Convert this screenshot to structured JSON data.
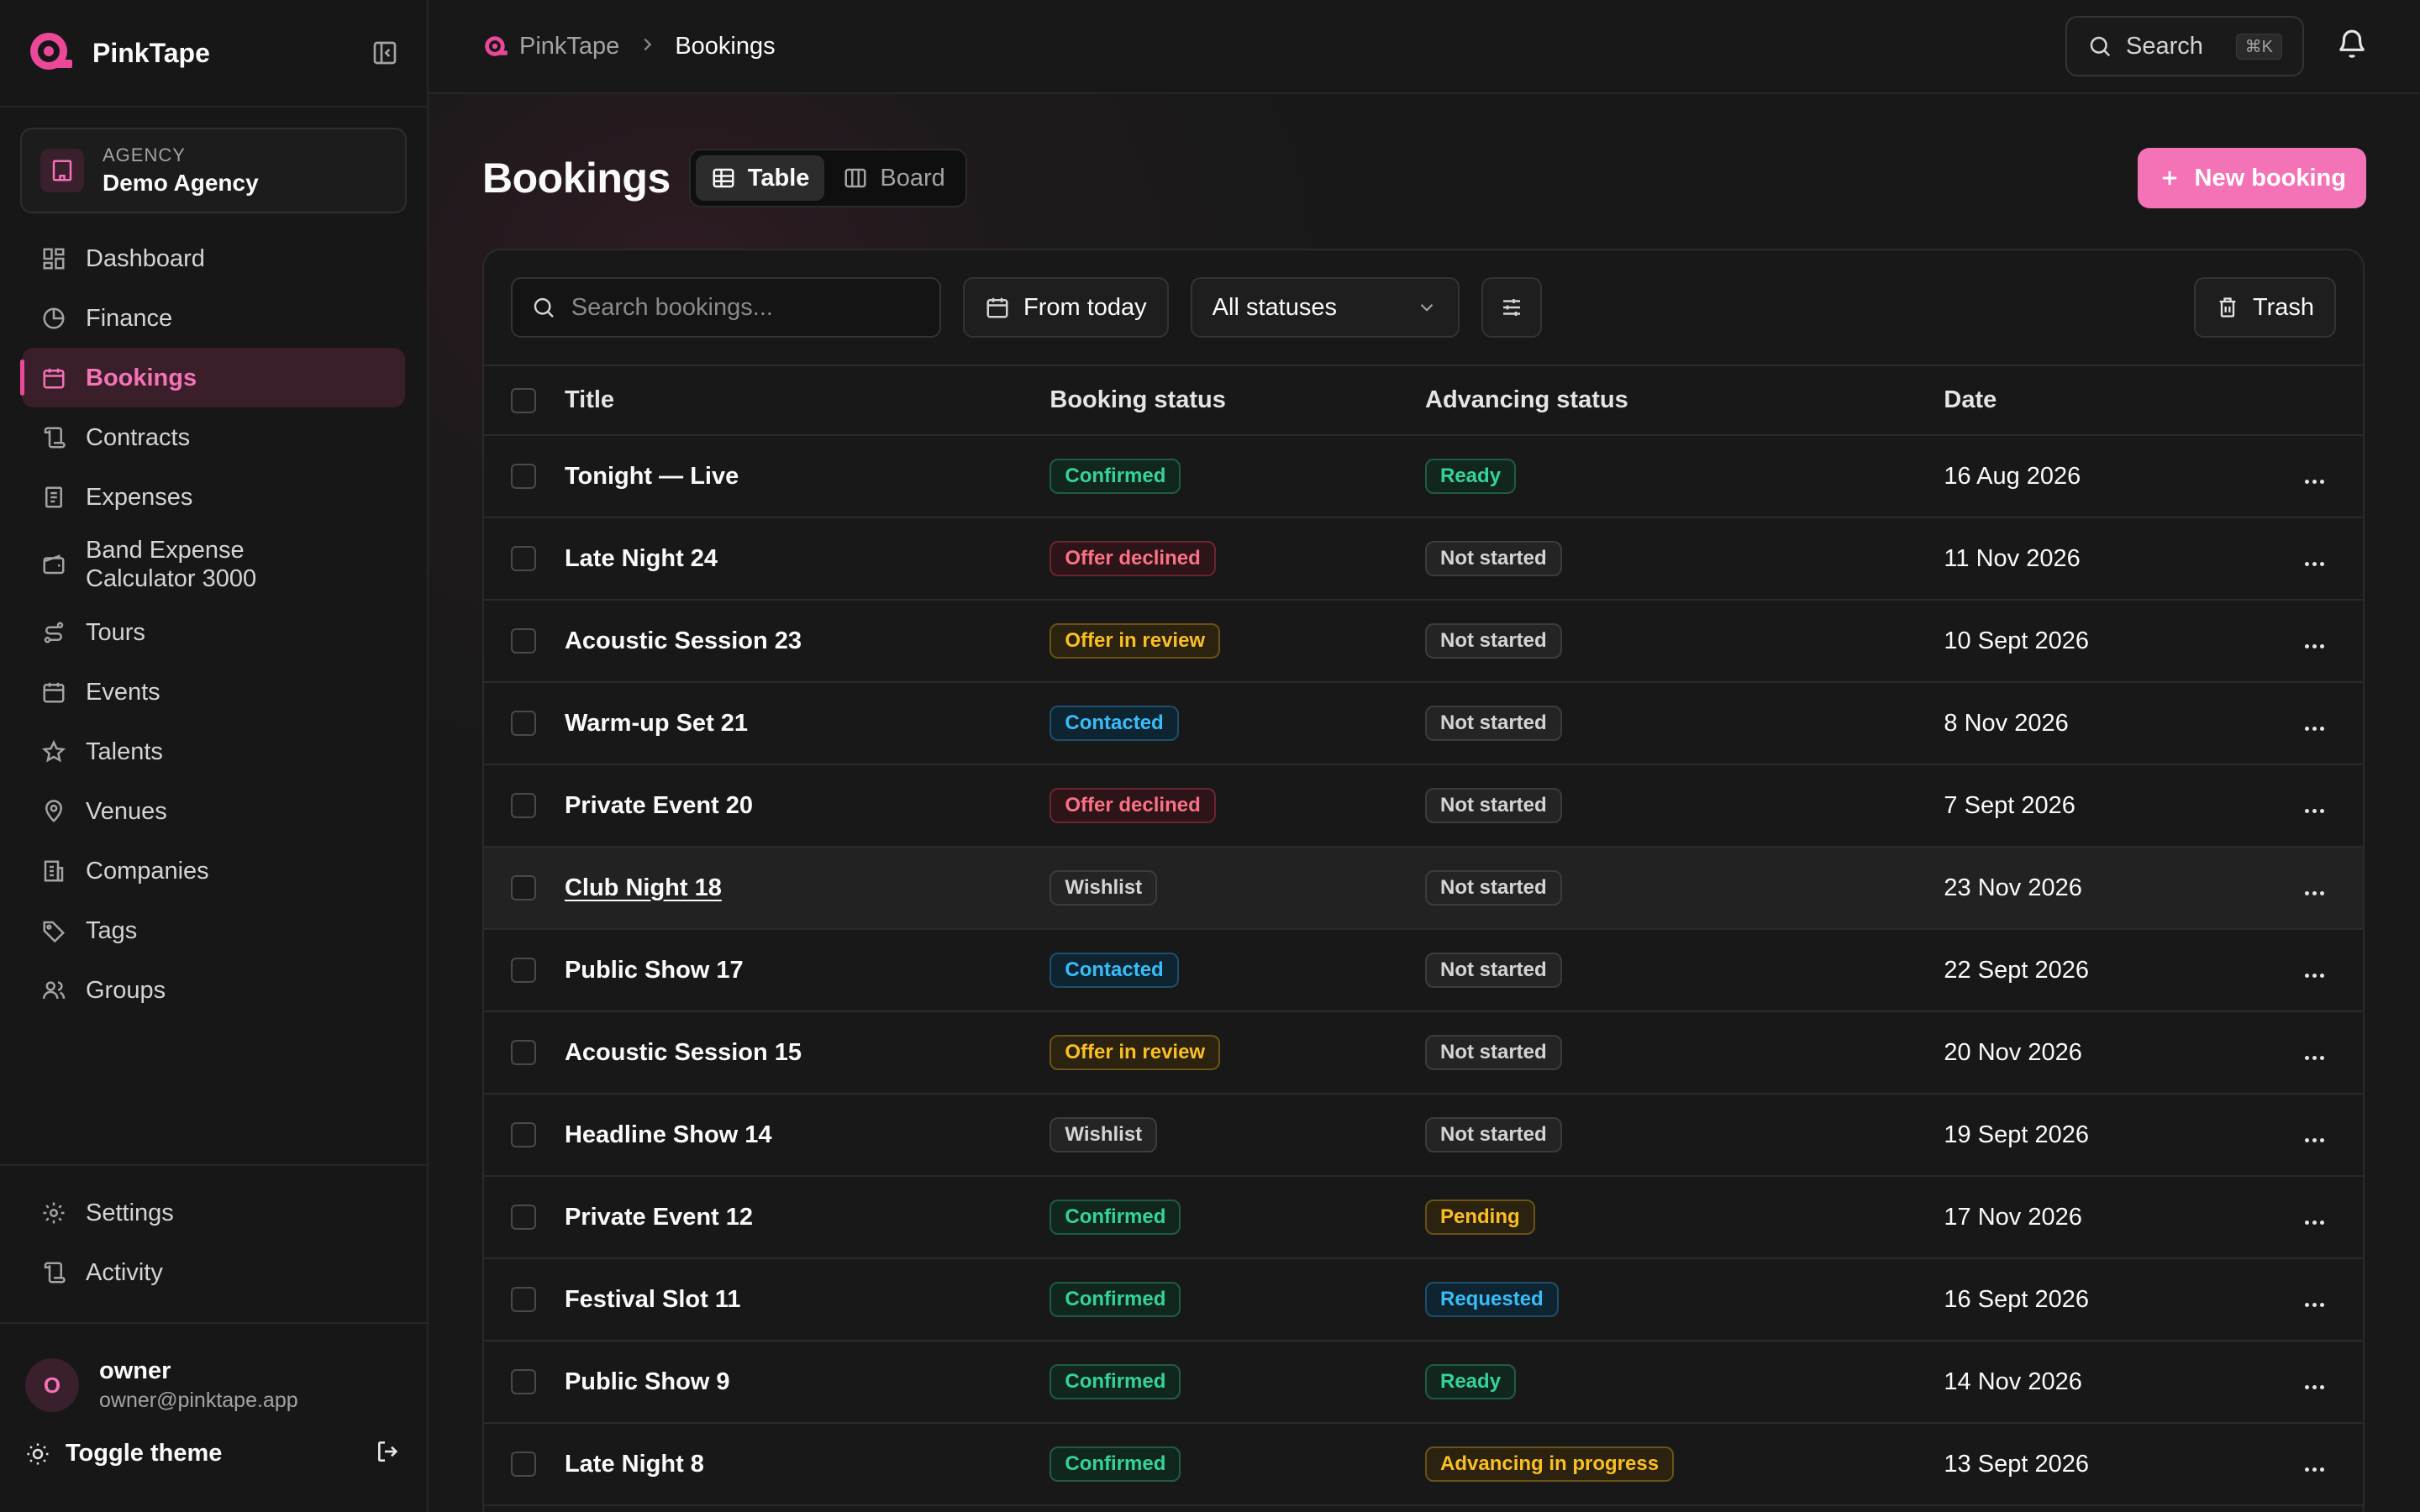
{
  "app": {
    "name": "PinkTape"
  },
  "org": {
    "kicker": "AGENCY",
    "name": "Demo Agency"
  },
  "nav": [
    {
      "label": "Dashboard",
      "icon": "dashboard-icon"
    },
    {
      "label": "Finance",
      "icon": "pie-chart-icon"
    },
    {
      "label": "Bookings",
      "icon": "calendar-icon",
      "active": true
    },
    {
      "label": "Contracts",
      "icon": "scroll-icon"
    },
    {
      "label": "Expenses",
      "icon": "receipt-icon"
    },
    {
      "label": "Band Expense Calculator 3000",
      "icon": "wallet-icon"
    },
    {
      "label": "Tours",
      "icon": "route-icon"
    },
    {
      "label": "Events",
      "icon": "calendar-icon"
    },
    {
      "label": "Talents",
      "icon": "star-icon"
    },
    {
      "label": "Venues",
      "icon": "map-pin-icon"
    },
    {
      "label": "Companies",
      "icon": "building-icon"
    },
    {
      "label": "Tags",
      "icon": "tag-icon"
    },
    {
      "label": "Groups",
      "icon": "users-icon"
    }
  ],
  "nav_bottom": [
    {
      "label": "Settings",
      "icon": "gear-icon"
    },
    {
      "label": "Activity",
      "icon": "scroll-icon"
    }
  ],
  "user": {
    "initial": "O",
    "name": "owner",
    "email": "owner@pinktape.app"
  },
  "theme": {
    "label": "Toggle theme"
  },
  "topbar": {
    "breadcrumb_root": "PinkTape",
    "breadcrumb_current": "Bookings",
    "search_label": "Search",
    "search_shortcut": "⌘K"
  },
  "page": {
    "title": "Bookings",
    "view_table": "Table",
    "view_board": "Board",
    "active_view": "Table",
    "new_button": "New booking"
  },
  "filters": {
    "search_placeholder": "Search bookings...",
    "date_filter": "From today",
    "status_filter": "All statuses",
    "trash": "Trash"
  },
  "table": {
    "columns": [
      "Title",
      "Booking status",
      "Advancing status",
      "Date"
    ],
    "rows": [
      {
        "title": "Tonight — Live",
        "booking_status": "Confirmed",
        "bs_color": "green",
        "advancing_status": "Ready",
        "as_color": "green",
        "date": "16 Aug 2026"
      },
      {
        "title": "Late Night 24",
        "booking_status": "Offer declined",
        "bs_color": "red",
        "advancing_status": "Not started",
        "as_color": "gray",
        "date": "11 Nov 2026"
      },
      {
        "title": "Acoustic Session 23",
        "booking_status": "Offer in review",
        "bs_color": "amber",
        "advancing_status": "Not started",
        "as_color": "gray",
        "date": "10 Sept 2026"
      },
      {
        "title": "Warm-up Set 21",
        "booking_status": "Contacted",
        "bs_color": "sky",
        "advancing_status": "Not started",
        "as_color": "gray",
        "date": "8 Nov 2026"
      },
      {
        "title": "Private Event 20",
        "booking_status": "Offer declined",
        "bs_color": "red",
        "advancing_status": "Not started",
        "as_color": "gray",
        "date": "7 Sept 2026"
      },
      {
        "title": "Club Night 18",
        "booking_status": "Wishlist",
        "bs_color": "gray",
        "advancing_status": "Not started",
        "as_color": "gray",
        "date": "23 Nov 2026",
        "hover": true
      },
      {
        "title": "Public Show 17",
        "booking_status": "Contacted",
        "bs_color": "sky",
        "advancing_status": "Not started",
        "as_color": "gray",
        "date": "22 Sept 2026"
      },
      {
        "title": "Acoustic Session 15",
        "booking_status": "Offer in review",
        "bs_color": "amber",
        "advancing_status": "Not started",
        "as_color": "gray",
        "date": "20 Nov 2026"
      },
      {
        "title": "Headline Show 14",
        "booking_status": "Wishlist",
        "bs_color": "gray",
        "advancing_status": "Not started",
        "as_color": "gray",
        "date": "19 Sept 2026"
      },
      {
        "title": "Private Event 12",
        "booking_status": "Confirmed",
        "bs_color": "green",
        "advancing_status": "Pending",
        "as_color": "amber",
        "date": "17 Nov 2026"
      },
      {
        "title": "Festival Slot 11",
        "booking_status": "Confirmed",
        "bs_color": "green",
        "advancing_status": "Requested",
        "as_color": "sky",
        "date": "16 Sept 2026"
      },
      {
        "title": "Public Show 9",
        "booking_status": "Confirmed",
        "bs_color": "green",
        "advancing_status": "Ready",
        "as_color": "green",
        "date": "14 Nov 2026"
      },
      {
        "title": "Late Night 8",
        "booking_status": "Confirmed",
        "bs_color": "green",
        "advancing_status": "Advancing in progress",
        "as_color": "amber",
        "date": "13 Sept 2026"
      }
    ]
  },
  "colors": {
    "accent": "#f472b6",
    "brand": "#ec4899",
    "background": "#141414"
  }
}
